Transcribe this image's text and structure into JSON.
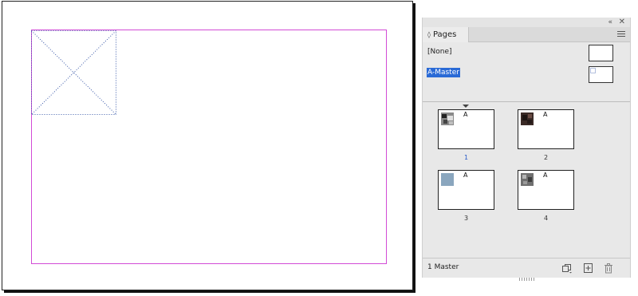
{
  "document": {},
  "panel": {
    "tab_label": "Pages",
    "tab_toggle_icon": "◊",
    "collapse_icon": "«",
    "close_icon": "✕",
    "masters": [
      {
        "label": "[None]",
        "selected": false
      },
      {
        "label": "A-Master",
        "selected": true
      }
    ],
    "pages": [
      {
        "number": "1",
        "master": "A",
        "thumb_color": "#555555",
        "active": true
      },
      {
        "number": "2",
        "master": "A",
        "thumb_color": "#3a2a26",
        "active": false
      },
      {
        "number": "3",
        "master": "A",
        "thumb_color": "#8aa6be",
        "active": false
      },
      {
        "number": "4",
        "master": "A",
        "thumb_color": "#6f6f6f",
        "active": false
      }
    ],
    "footer_status": "1 Master",
    "colors": {
      "selection": "#2a6ad6",
      "margin_guide": "#d24bd6",
      "active_page_number": "#2a5cc8"
    }
  }
}
